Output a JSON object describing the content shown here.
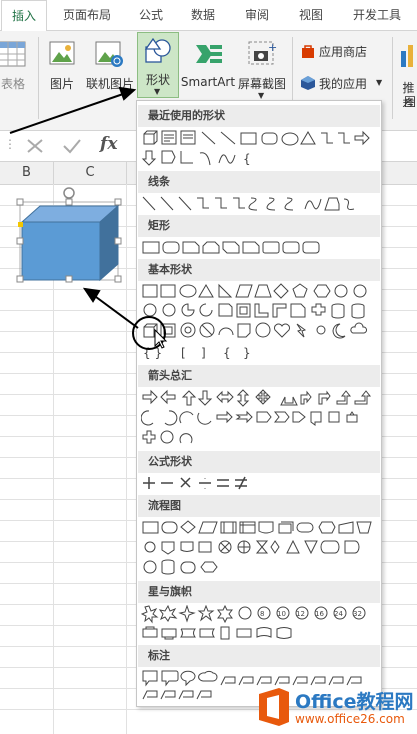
{
  "tabs": [
    "插入",
    "页面布局",
    "公式",
    "数据",
    "审阅",
    "视图",
    "开发工具"
  ],
  "active_tab": "插入",
  "ribbon": {
    "table_label": "表格",
    "picture": "图片",
    "online_picture": "联机图片",
    "shapes": "形状",
    "smartart": "SmartArt",
    "screenshot": "屏幕截图",
    "app_store": "应用商店",
    "my_apps": "我的应用",
    "recommend": "推荐",
    "recommend2": "图"
  },
  "formula_bar": {
    "fx": "fx"
  },
  "columns": [
    "B",
    "C"
  ],
  "dropdown": {
    "sections": [
      "最近使用的形状",
      "线条",
      "矩形",
      "基本形状",
      "箭头总汇",
      "公式形状",
      "流程图",
      "星与旗帜",
      "标注"
    ]
  },
  "watermark": {
    "title": "Office教程网",
    "url": "www.office26.com"
  },
  "colors": {
    "accent": "#217346",
    "shape_fill": "#5b9bd5",
    "highlight": "#cde6c7"
  }
}
